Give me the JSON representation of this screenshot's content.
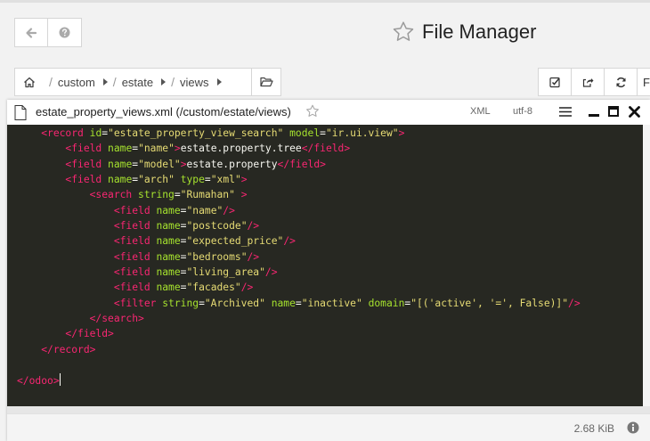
{
  "header": {
    "title": "File Manager"
  },
  "breadcrumb": {
    "items": [
      {
        "label": "custom"
      },
      {
        "label": "estate"
      },
      {
        "label": "views"
      }
    ]
  },
  "editor": {
    "title": "estate_property_views.xml (/custom/estate/views)",
    "language": "XML",
    "encoding": "utf-8",
    "file_size": "2.68 KiB"
  },
  "code": {
    "lines": [
      "    <record id=\"estate_property_view_search\" model=\"ir.ui.view\">",
      "        <field name=\"name\">estate.property.tree</field>",
      "        <field name=\"model\">estate.property</field>",
      "        <field name=\"arch\" type=\"xml\">",
      "            <search string=\"Rumahan\" >",
      "                <field name=\"name\"/>",
      "                <field name=\"postcode\"/>",
      "                <field name=\"expected_price\"/>",
      "                <field name=\"bedrooms\"/>",
      "                <field name=\"living_area\"/>",
      "                <field name=\"facades\"/>",
      "                <filter string=\"Archived\" name=\"inactive\" domain=\"[('active', '=', False)]\"/>",
      "            </search>",
      "        </field>",
      "    </record>",
      "",
      "</odoo>"
    ]
  },
  "colors": {
    "editor_bg": "#272822",
    "tag": "#f92672",
    "attr": "#a6e22e",
    "string": "#e6db74",
    "text": "#f8f8f2"
  }
}
